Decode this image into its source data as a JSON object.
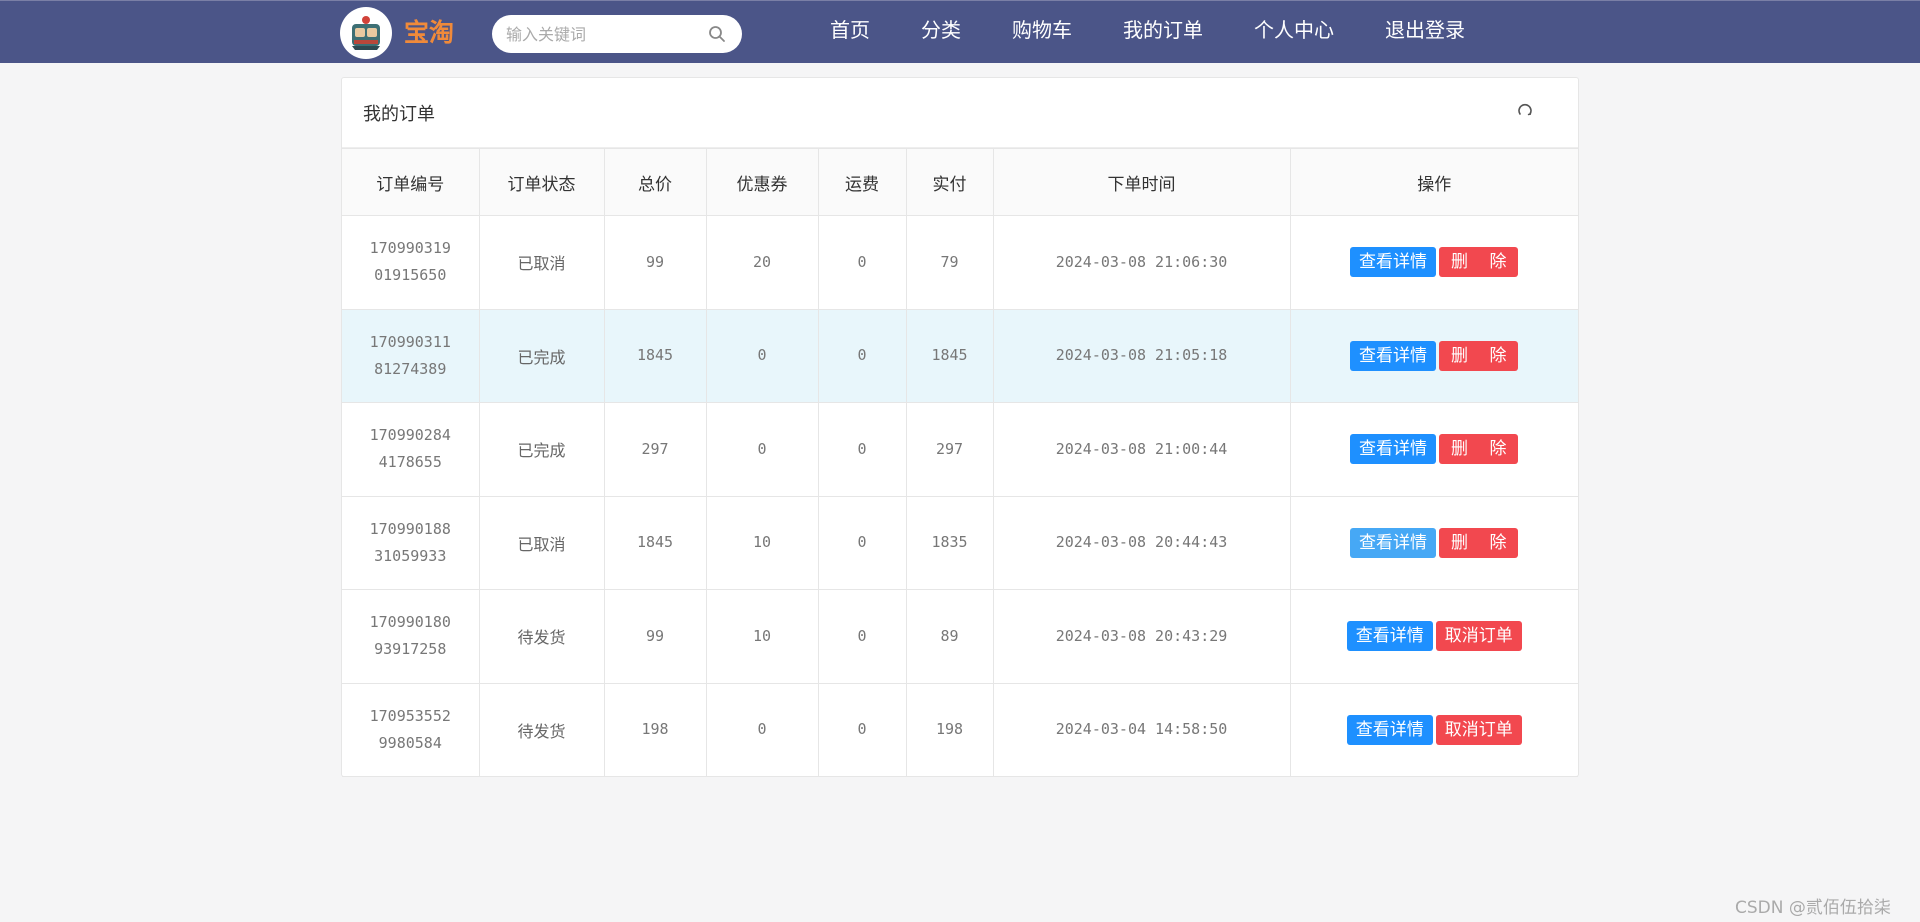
{
  "header": {
    "brand": "宝淘",
    "search_placeholder": "输入关键词",
    "nav": [
      "首页",
      "分类",
      "购物车",
      "我的订单",
      "个人中心",
      "退出登录"
    ]
  },
  "panel": {
    "title": "我的订单"
  },
  "table": {
    "columns": [
      "订单编号",
      "订单状态",
      "总价",
      "优惠券",
      "运费",
      "实付",
      "下单时间",
      "操作"
    ],
    "rows": [
      {
        "id_line1": "170990319",
        "id_line2": "01915650",
        "status": "已取消",
        "total": "99",
        "coupon": "20",
        "shipping": "0",
        "paid": "79",
        "time": "2024-03-08 21:06:30",
        "action1": "查看详情",
        "action2": "删 除"
      },
      {
        "id_line1": "170990311",
        "id_line2": "81274389",
        "status": "已完成",
        "total": "1845",
        "coupon": "0",
        "shipping": "0",
        "paid": "1845",
        "time": "2024-03-08 21:05:18",
        "action1": "查看详情",
        "action2": "删 除"
      },
      {
        "id_line1": "170990284",
        "id_line2": "4178655",
        "status": "已完成",
        "total": "297",
        "coupon": "0",
        "shipping": "0",
        "paid": "297",
        "time": "2024-03-08 21:00:44",
        "action1": "查看详情",
        "action2": "删 除"
      },
      {
        "id_line1": "170990188",
        "id_line2": "31059933",
        "status": "已取消",
        "total": "1845",
        "coupon": "10",
        "shipping": "0",
        "paid": "1835",
        "time": "2024-03-08 20:44:43",
        "action1": "查看详情",
        "action2": "删 除"
      },
      {
        "id_line1": "170990180",
        "id_line2": "93917258",
        "status": "待发货",
        "total": "99",
        "coupon": "10",
        "shipping": "0",
        "paid": "89",
        "time": "2024-03-08 20:43:29",
        "action1": "查看详情",
        "action2": "取消订单"
      },
      {
        "id_line1": "170953552",
        "id_line2": "9980584",
        "status": "待发货",
        "total": "198",
        "coupon": "0",
        "shipping": "0",
        "paid": "198",
        "time": "2024-03-04 14:58:50",
        "action1": "查看详情",
        "action2": "取消订单"
      }
    ]
  },
  "watermark": "CSDN @贰佰伍拾柒",
  "colors": {
    "header_bg": "#4b5588",
    "brand": "#f08a3a",
    "primary_button": "#1e90ff",
    "danger_button": "#f2484f",
    "row_highlight": "#e8f6fb"
  }
}
